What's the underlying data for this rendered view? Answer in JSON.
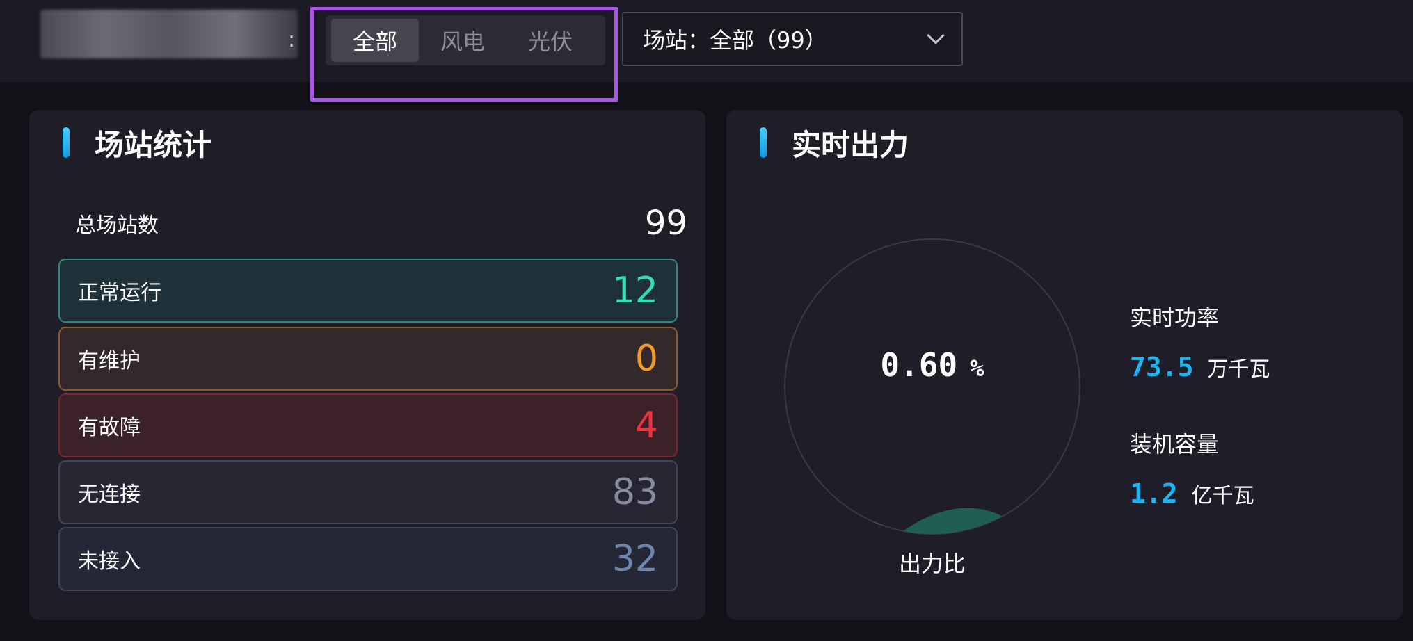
{
  "header": {
    "type_tabs": [
      {
        "label": "全部",
        "active": true
      },
      {
        "label": "风电",
        "active": false
      },
      {
        "label": "光伏",
        "active": false
      }
    ],
    "station_select": {
      "value": "场站：全部（99）"
    }
  },
  "station_stats": {
    "title": "场站统计",
    "total_label": "总场站数",
    "total_value": "99",
    "rows": [
      {
        "label": "正常运行",
        "value": "12"
      },
      {
        "label": "有维护",
        "value": "0"
      },
      {
        "label": "有故障",
        "value": "4"
      },
      {
        "label": "无连接",
        "value": "83"
      },
      {
        "label": "未接入",
        "value": "32"
      }
    ]
  },
  "realtime_output": {
    "title": "实时出力",
    "ratio_value": "0.60",
    "ratio_unit": "%",
    "ratio_label": "出力比",
    "power_label": "实时功率",
    "power_value": "73.5",
    "power_unit": "万千瓦",
    "capacity_label": "装机容量",
    "capacity_value": "1.2",
    "capacity_unit": "亿千瓦"
  },
  "colors": {
    "accent_blue": "#1fb3f2",
    "normal": "#2fe3b7",
    "maintenance": "#f59a27",
    "fault": "#f0333f",
    "no_link": "#8a8ba3",
    "no_access": "#6f86ad",
    "highlight": "#a855e8"
  }
}
